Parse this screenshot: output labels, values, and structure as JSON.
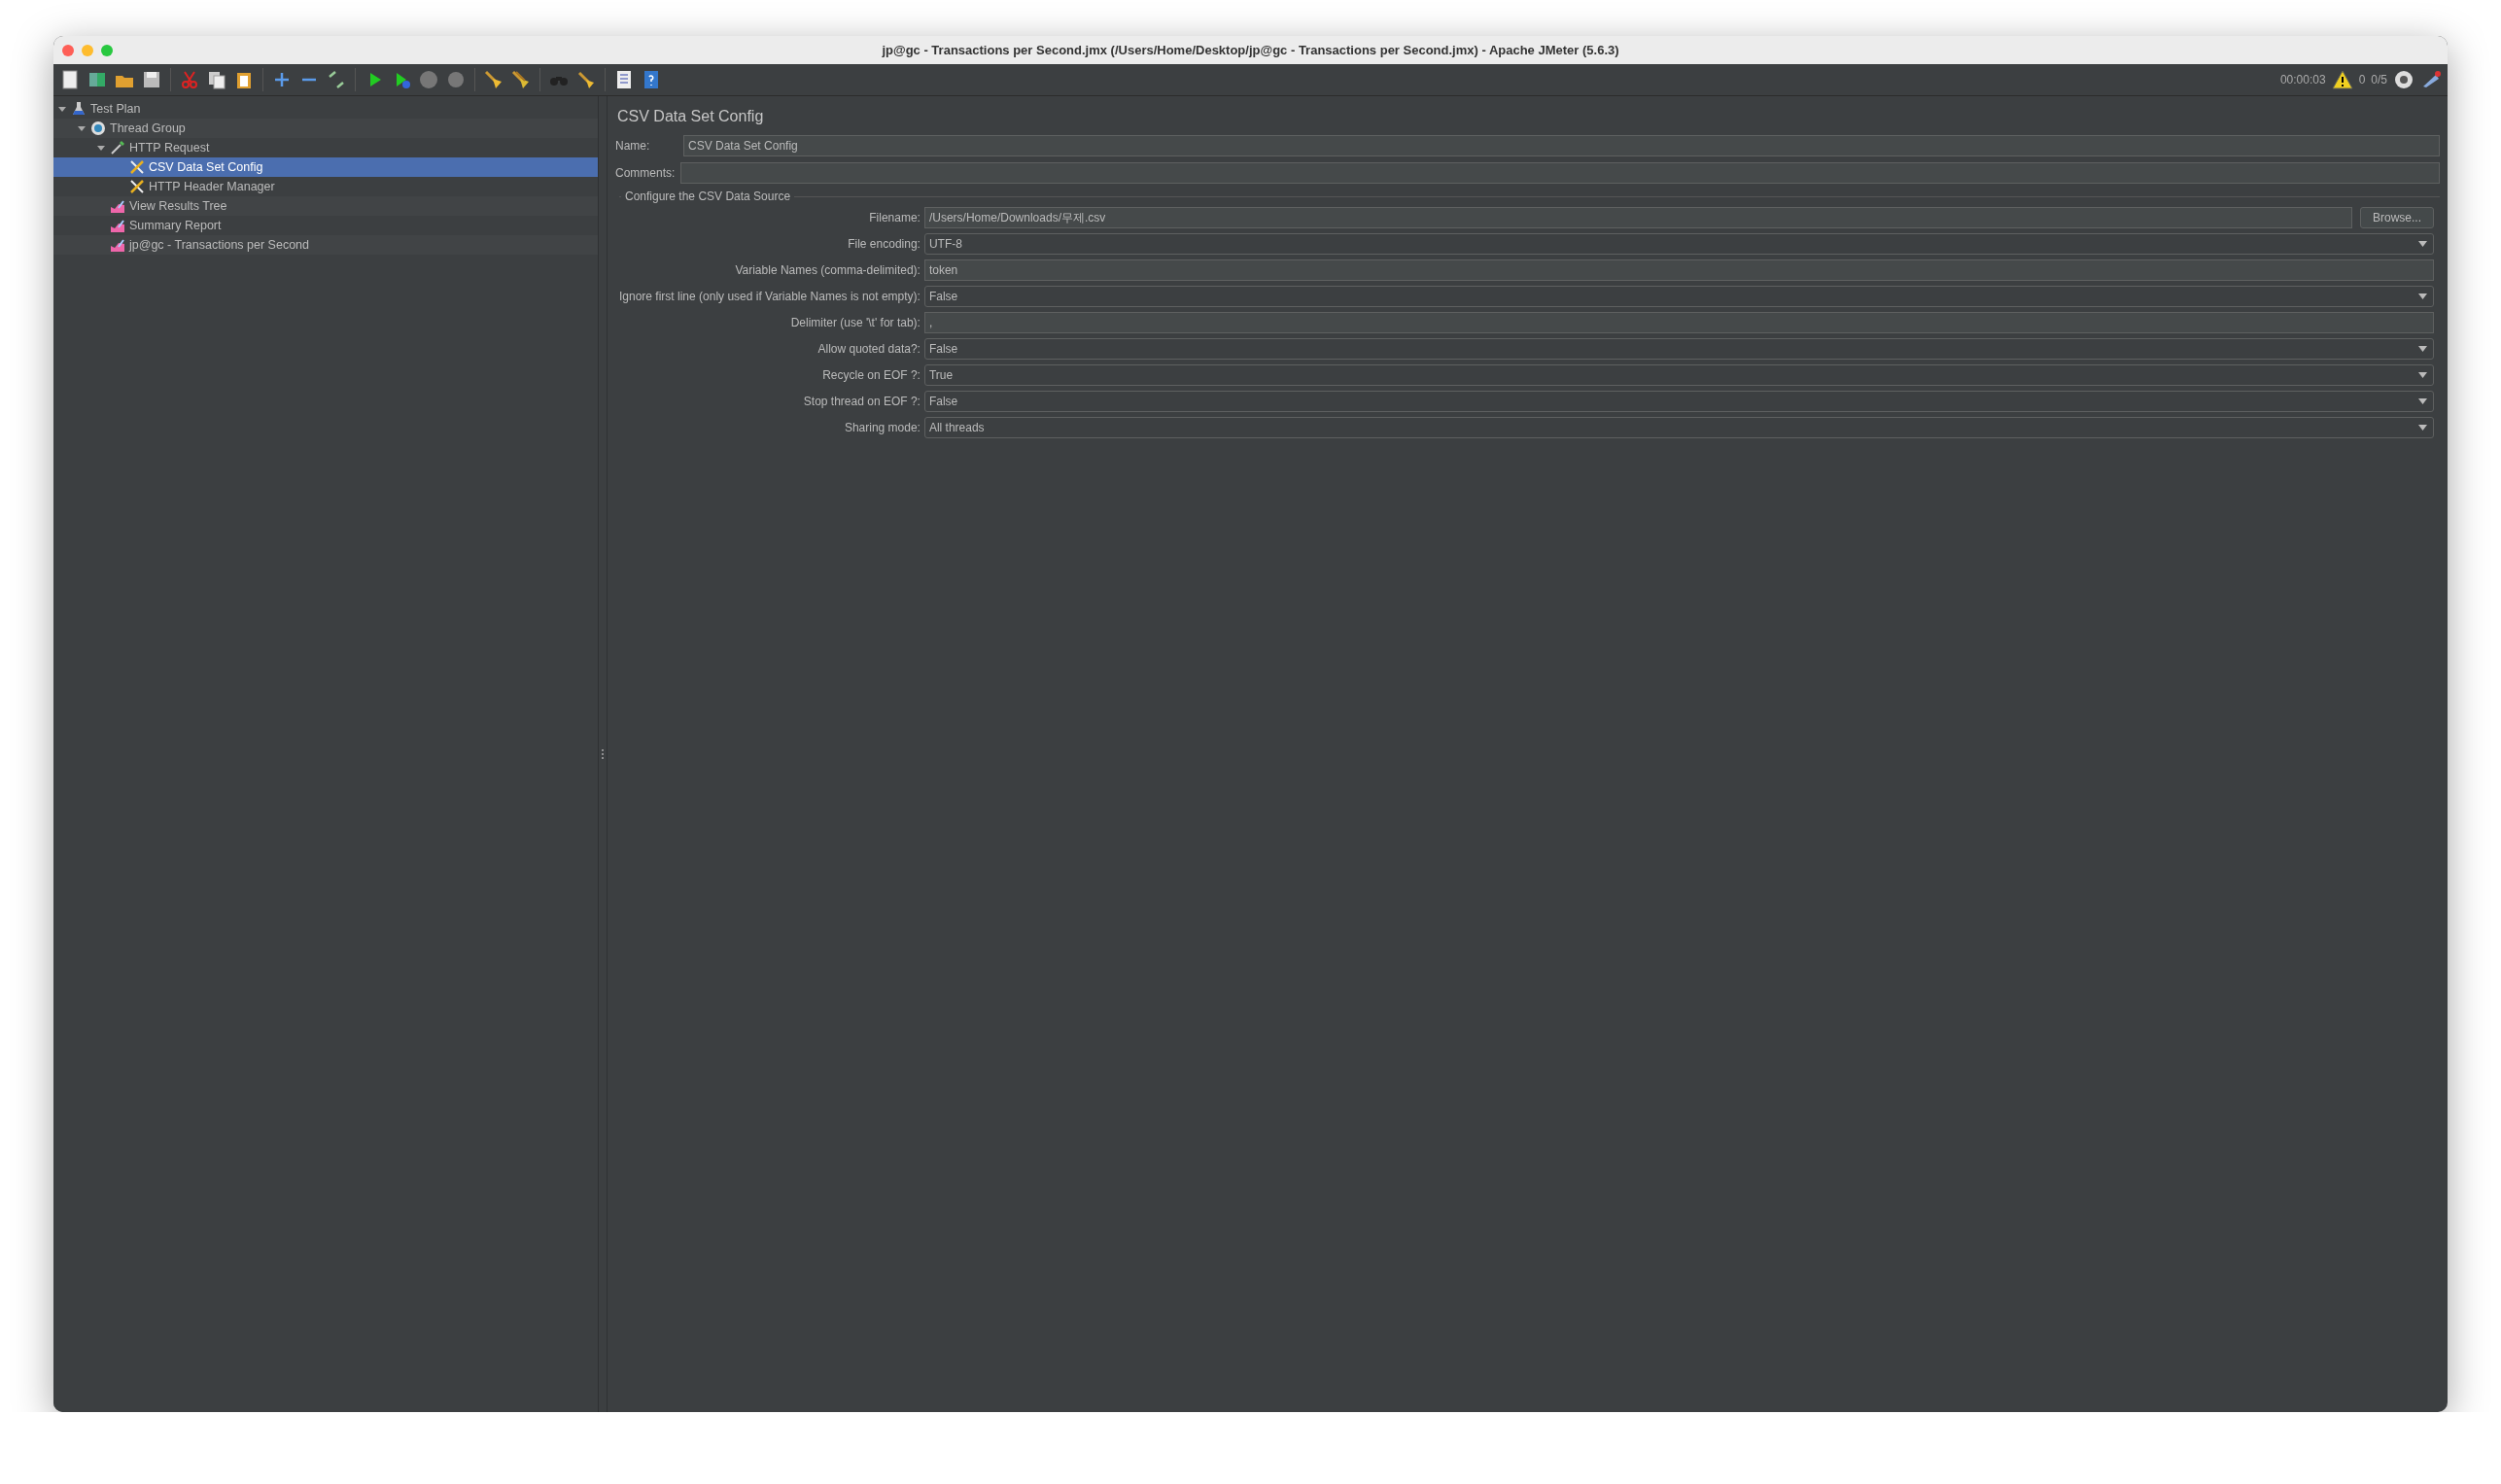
{
  "window": {
    "title": "jp@gc - Transactions per Second.jmx (/Users/Home/Desktop/jp@gc - Transactions per Second.jmx) - Apache JMeter (5.6.3)"
  },
  "status": {
    "timer": "00:00:03",
    "errors": "0",
    "threads": "0/5"
  },
  "tree": [
    {
      "label": "Test Plan",
      "kind": "plan",
      "selected": false,
      "expanded": true,
      "children": [
        {
          "label": "Thread Group",
          "kind": "threads",
          "selected": false,
          "expanded": true,
          "children": [
            {
              "label": "HTTP Request",
              "kind": "sampler",
              "selected": false,
              "expanded": true,
              "children": [
                {
                  "label": "CSV Data Set Config",
                  "kind": "config",
                  "selected": true
                },
                {
                  "label": "HTTP Header Manager",
                  "kind": "config",
                  "selected": false
                }
              ]
            },
            {
              "label": "View Results Tree",
              "kind": "listener",
              "selected": false
            },
            {
              "label": "Summary Report",
              "kind": "listener",
              "selected": false
            },
            {
              "label": "jp@gc - Transactions per Second",
              "kind": "listener",
              "selected": false
            }
          ]
        }
      ]
    }
  ],
  "panel": {
    "title": "CSV Data Set Config",
    "name_label": "Name:",
    "name_value": "CSV Data Set Config",
    "comments_label": "Comments:",
    "group_title": "Configure the CSV Data Source",
    "rows": [
      {
        "label": "Filename:",
        "value": "/Users/Home/Downloads/무제.csv",
        "kind": "file",
        "button": "Browse..."
      },
      {
        "label": "File encoding:",
        "value": "UTF-8",
        "kind": "select"
      },
      {
        "label": "Variable Names (comma-delimited):",
        "value": "token",
        "kind": "text"
      },
      {
        "label": "Ignore first line (only used if Variable Names is not empty):",
        "value": "False",
        "kind": "select"
      },
      {
        "label": "Delimiter (use '\\t' for tab):",
        "value": ",",
        "kind": "text"
      },
      {
        "label": "Allow quoted data?:",
        "value": "False",
        "kind": "select"
      },
      {
        "label": "Recycle on EOF ?:",
        "value": "True",
        "kind": "select"
      },
      {
        "label": "Stop thread on EOF ?:",
        "value": "False",
        "kind": "select"
      },
      {
        "label": "Sharing mode:",
        "value": "All threads",
        "kind": "select"
      }
    ]
  }
}
